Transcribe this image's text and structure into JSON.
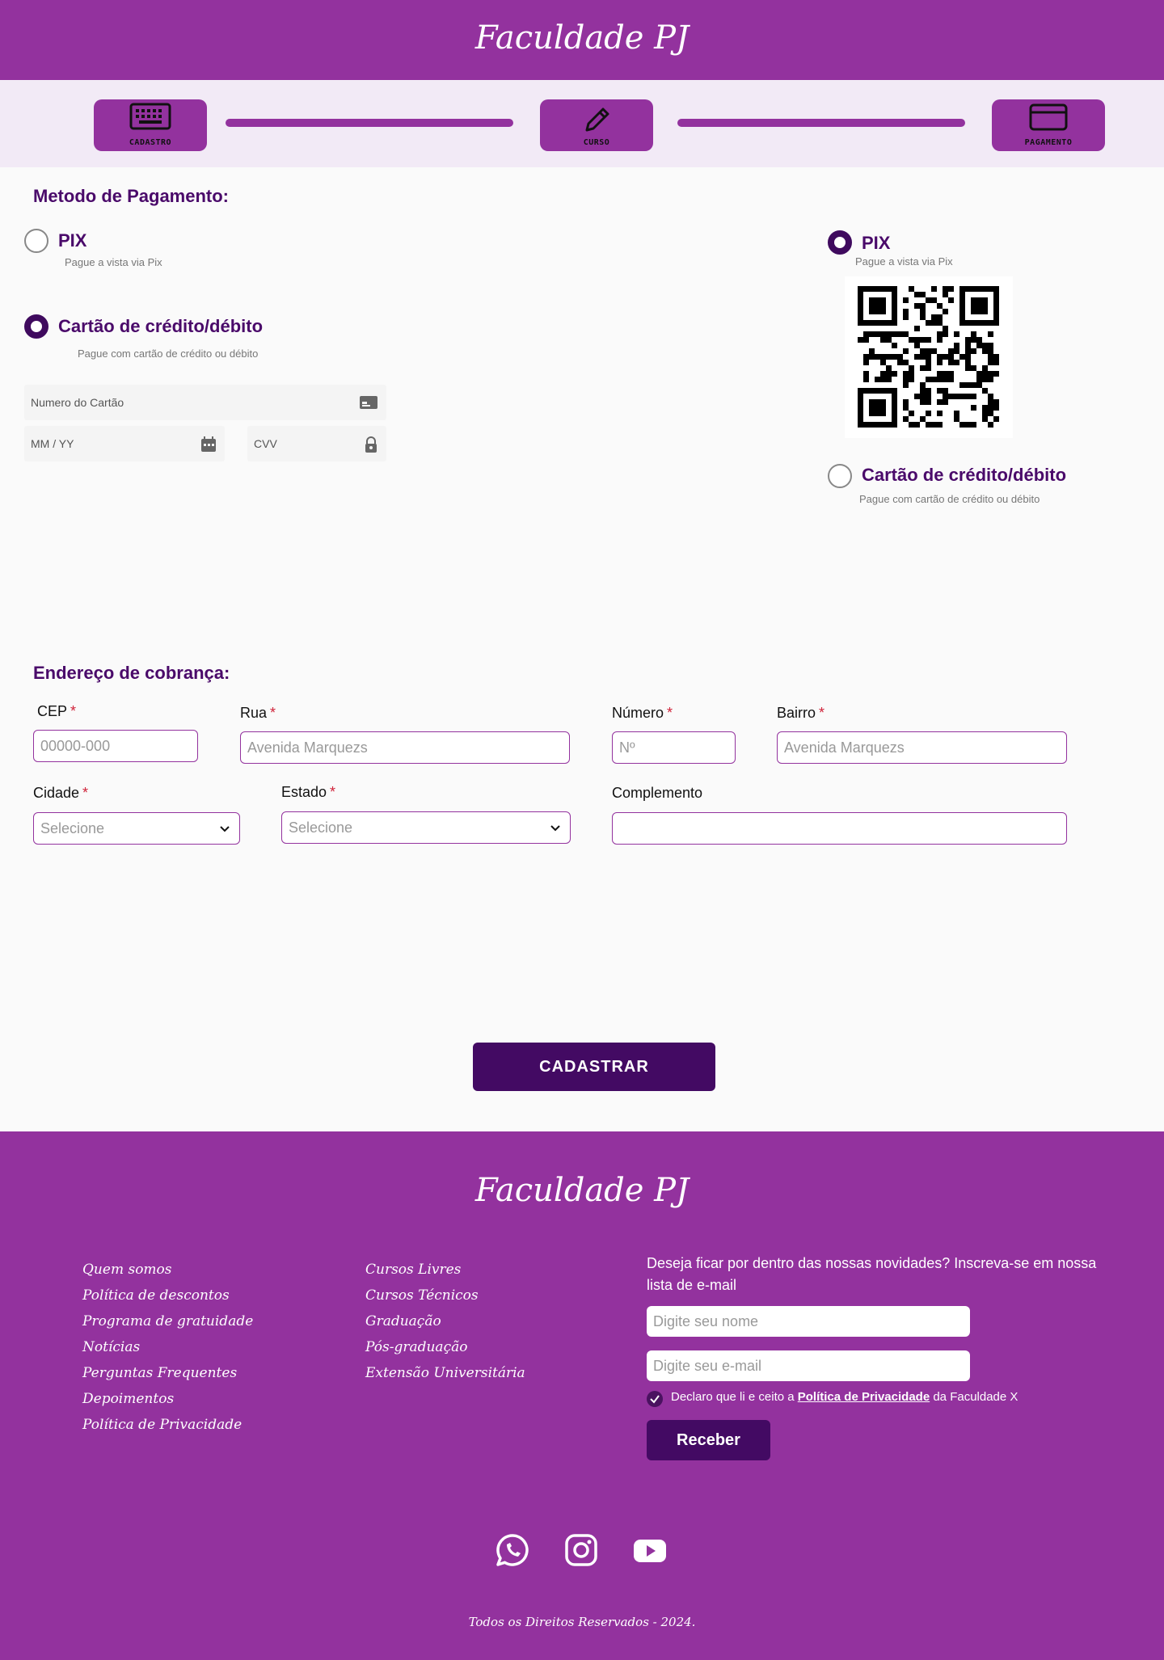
{
  "header": {
    "brand": "Faculdade PJ"
  },
  "stepper": {
    "steps": [
      {
        "label": "CADASTRO",
        "icon": "keyboard-icon"
      },
      {
        "label": "CURSO",
        "icon": "pencil-icon"
      },
      {
        "label": "PAGAMENTO",
        "icon": "credit-card-icon"
      }
    ]
  },
  "payment": {
    "title": "Metodo de Pagamento:",
    "left": {
      "pix_title": "PIX",
      "pix_sub": "Pague a vista via Pix",
      "card_title": "Cartão de crédito/débito",
      "card_sub": "Pague com cartão de crédito ou débito",
      "selected": "card"
    },
    "card_form": {
      "number_placeholder": "Numero do Cartão",
      "expiry_placeholder": "MM / YY",
      "cvv_placeholder": "CVV"
    },
    "right": {
      "pix_title": "PIX",
      "pix_sub": "Pague a vista via Pix",
      "card_title": "Cartão de crédito/débito",
      "card_sub": "Pague com cartão de crédito ou débito",
      "selected": "pix"
    }
  },
  "address": {
    "title": "Endereço de cobrança:",
    "cep": {
      "label": "CEP",
      "placeholder": "00000-000"
    },
    "rua": {
      "label": "Rua",
      "placeholder": "Avenida Marquezs"
    },
    "numero": {
      "label": "Número",
      "placeholder": "Nº"
    },
    "bairro": {
      "label": "Bairro",
      "placeholder": "Avenida Marquezs"
    },
    "cidade": {
      "label": "Cidade",
      "placeholder": "Selecione"
    },
    "estado": {
      "label": "Estado",
      "placeholder": "Selecione"
    },
    "complemento": {
      "label": "Complemento",
      "placeholder": ""
    },
    "required_mark": "*"
  },
  "submit_label": "CADASTRAR",
  "footer": {
    "brand": "Faculdade PJ",
    "col1": [
      "Quem somos",
      "Política de descontos",
      "Programa de gratuidade",
      "Notícias",
      "Perguntas Frequentes",
      "Depoimentos",
      "Política de Privacidade"
    ],
    "col2": [
      "Cursos Livres",
      "Cursos Técnicos",
      "Graduação",
      "Pós-graduação",
      "Extensão Universitária"
    ],
    "newsletter": {
      "text": "Deseja ficar por dentro das nossas novidades? Inscreva-se em nossa lista de e-mail",
      "name_placeholder": "Digite seu nome",
      "email_placeholder": "Digite seu e-mail",
      "consent_prefix": "Declaro que li e ceito a",
      "consent_link": "Política de Privacidade",
      "consent_suffix": "da Faculdade X",
      "button": "Receber"
    },
    "social": [
      "whatsapp-icon",
      "instagram-icon",
      "youtube-icon"
    ],
    "copyright": "Todos os Direitos Reservados - 2024."
  },
  "colors": {
    "primary": "#93329e",
    "dark": "#430a63",
    "title": "#4a0a6a",
    "required": "#d0233a"
  }
}
